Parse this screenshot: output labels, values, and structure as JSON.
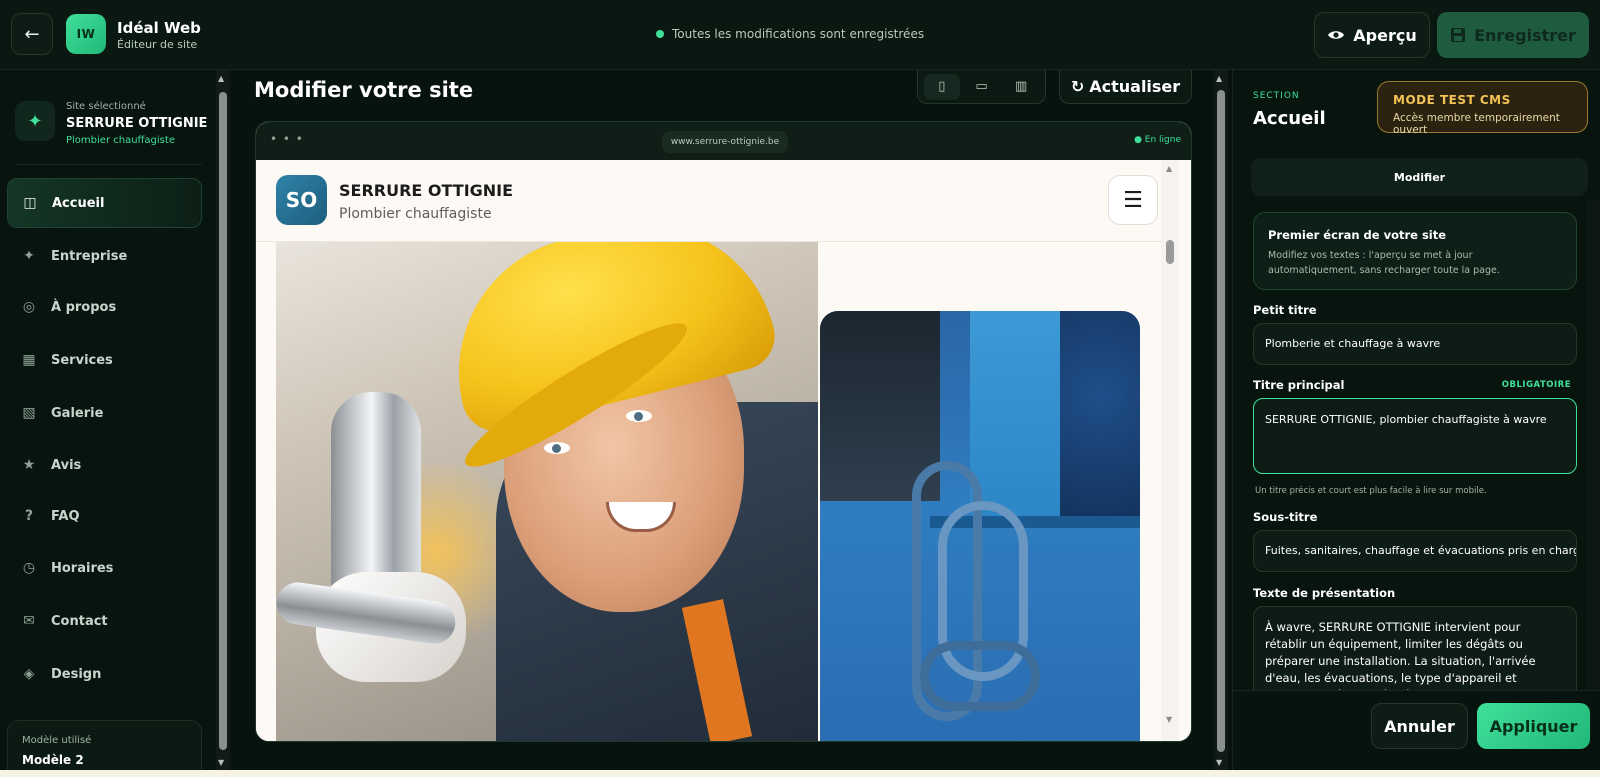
{
  "topbar": {
    "back_icon": "←",
    "logo_initials": "IW",
    "app_name": "Idéal Web",
    "app_subtitle": "Éditeur de site",
    "save_status": "Toutes les modifications sont enregistrées",
    "preview_label": "Aperçu",
    "save_label": "Enregistrer"
  },
  "sidebar": {
    "selected_caption": "Site sélectionné",
    "site_name": "SERRURE OTTIGNIE",
    "site_type": "Plombier chauffagiste",
    "items": [
      {
        "label": "Accueil",
        "icon": "layout-icon",
        "glyph": "◫"
      },
      {
        "label": "Entreprise",
        "icon": "sparkle-icon",
        "glyph": "✦"
      },
      {
        "label": "À propos",
        "icon": "target-icon",
        "glyph": "◎"
      },
      {
        "label": "Services",
        "icon": "grid-icon",
        "glyph": "▦"
      },
      {
        "label": "Galerie",
        "icon": "gallery-icon",
        "glyph": "▧"
      },
      {
        "label": "Avis",
        "icon": "star-icon",
        "glyph": "★"
      },
      {
        "label": "FAQ",
        "icon": "question-icon",
        "glyph": "?"
      },
      {
        "label": "Horaires",
        "icon": "clock-icon",
        "glyph": "◷"
      },
      {
        "label": "Contact",
        "icon": "mail-icon",
        "glyph": "✉"
      },
      {
        "label": "Design",
        "icon": "diamond-icon",
        "glyph": "◈"
      }
    ],
    "model_caption": "Modèle utilisé",
    "model_name": "Modèle 2"
  },
  "editor": {
    "title": "Modifier votre site",
    "refresh_label": "Actualiser",
    "devices": [
      {
        "icon": "mobile-icon",
        "glyph": "▯"
      },
      {
        "icon": "tablet-icon",
        "glyph": "▭"
      },
      {
        "icon": "desktop-icon",
        "glyph": "▥"
      }
    ]
  },
  "preview": {
    "dots": "• • •",
    "url": "www.serrure-ottignie.be",
    "online": "● En ligne",
    "logo_initials": "SO",
    "site_name": "SERRURE OTTIGNIE",
    "site_type": "Plombier chauffagiste",
    "menu_icon": "☰"
  },
  "panel": {
    "section_caption": "SECTION",
    "section_title": "Accueil",
    "mode_title": "MODE TEST CMS",
    "mode_subtitle": "Accès membre temporairement ouvert",
    "tab_label": "Modifier",
    "info_title": "Premier écran de votre site",
    "info_text": "Modifiez vos textes : l'aperçu se met à jour automatiquement, sans recharger toute la page.",
    "fields": {
      "petit_titre_label": "Petit titre",
      "petit_titre_value": "Plomberie et chauffage à wavre",
      "titre_label": "Titre principal",
      "titre_required": "OBLIGATOIRE",
      "titre_value": "SERRURE OTTIGNIE, plombier chauffagiste à wavre",
      "titre_hint": "Un titre précis et court est plus facile à lire sur mobile.",
      "sous_titre_label": "Sous-titre",
      "sous_titre_value": "Fuites, sanitaires, chauffage et évacuations pris en charge a",
      "texte_label": "Texte de présentation",
      "texte_value": "À wavre, SERRURE OTTIGNIE intervient pour rétablir un équipement, limiter les dégâts ou préparer une installation. La situation, l'arrivée d'eau, les évacuations, le type d'appareil et l'accessibilité sont vérifiés avant de"
    },
    "cancel_label": "Annuler",
    "apply_label": "Appliquer"
  }
}
